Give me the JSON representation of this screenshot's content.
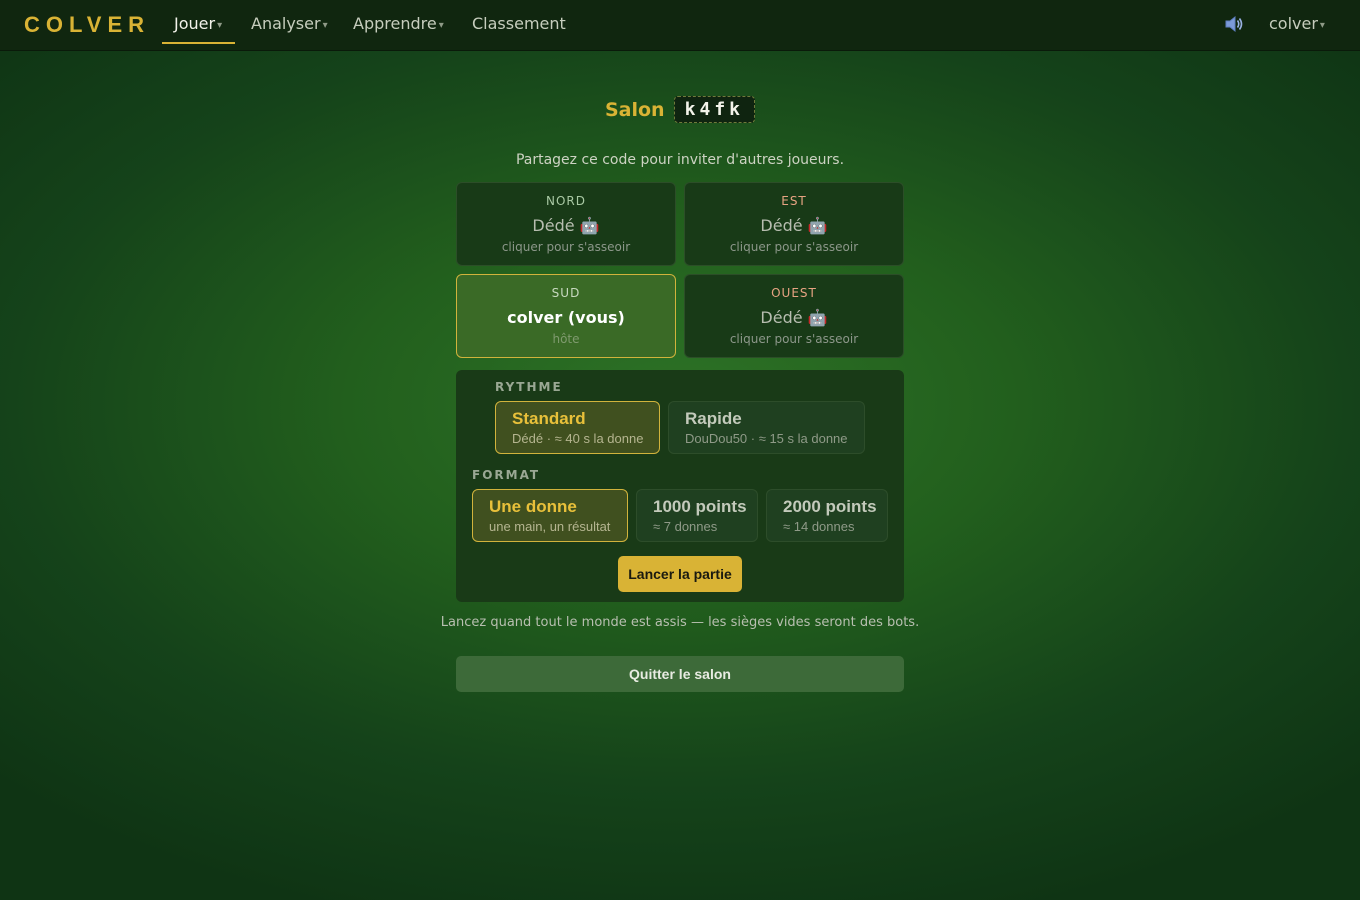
{
  "nav": {
    "logo": "COLVER",
    "items": [
      {
        "label": "Jouer",
        "has_menu": true,
        "active": true
      },
      {
        "label": "Analyser",
        "has_menu": true,
        "active": false
      },
      {
        "label": "Apprendre",
        "has_menu": true,
        "active": false
      },
      {
        "label": "Classement",
        "has_menu": false,
        "active": false
      }
    ],
    "caret": "▾",
    "sound_icon": "speaker-icon",
    "user": "colver"
  },
  "salon": {
    "label": "Salon",
    "code": "k4fk",
    "share_text": "Partagez ce code pour inviter d'autres joueurs."
  },
  "seats": [
    {
      "position": "NORD",
      "name": "Dédé 🤖",
      "hint": "cliquer pour s'asseoir",
      "is_me": false
    },
    {
      "position": "EST",
      "name": "Dédé 🤖",
      "hint": "cliquer pour s'asseoir",
      "is_me": false
    },
    {
      "position": "SUD",
      "name": "colver (vous)",
      "hint": "hôte",
      "is_me": true
    },
    {
      "position": "OUEST",
      "name": "Dédé 🤖",
      "hint": "cliquer pour s'asseoir",
      "is_me": false
    }
  ],
  "settings": {
    "rythme_label": "RYTHME",
    "rythme_options": [
      {
        "title": "Standard",
        "subtitle": "Dédé · ≈ 40 s la donne",
        "selected": true
      },
      {
        "title": "Rapide",
        "subtitle": "DouDou50 · ≈ 15 s la donne",
        "selected": false
      }
    ],
    "format_label": "FORMAT",
    "format_options": [
      {
        "title": "Une donne",
        "subtitle": "une main, un résultat",
        "selected": true
      },
      {
        "title": "1000 points",
        "subtitle": "≈ 7 donnes",
        "selected": false
      },
      {
        "title": "2000 points",
        "subtitle": "≈ 14 donnes",
        "selected": false
      }
    ],
    "launch_label": "Lancer la partie"
  },
  "footer": {
    "note": "Lancez quand tout le monde est assis — les sièges vides seront des bots.",
    "quit_label": "Quitter le salon"
  },
  "colors": {
    "accent": "#d9b335",
    "nav_bg": "#10260f",
    "felt": "#2d7226",
    "warn": "#e6a382"
  }
}
